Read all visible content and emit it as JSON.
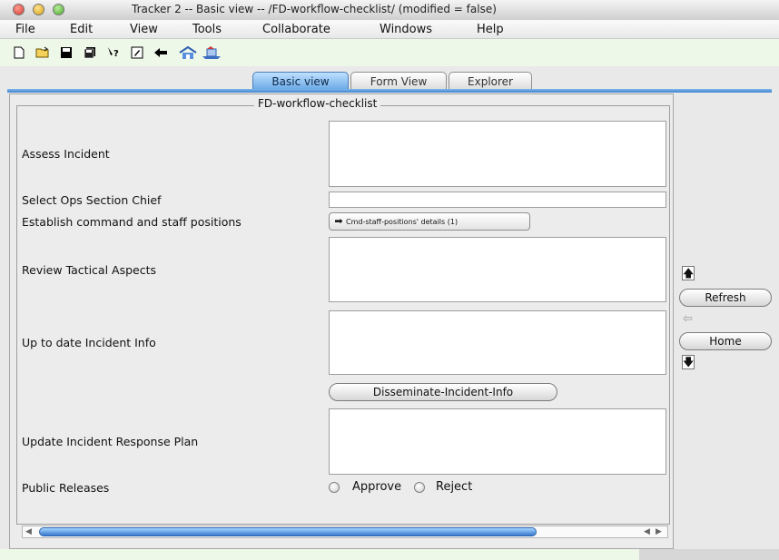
{
  "window": {
    "title": "Tracker 2 -- Basic view -- /FD-workflow-checklist/   (modified = false)"
  },
  "menu": [
    "File",
    "Edit",
    "View",
    "Tools",
    "Collaborate",
    "Windows",
    "Help"
  ],
  "toolbar": {
    "icons": [
      "new-document-icon",
      "open-folder-icon",
      "save-icon",
      "save-all-icon",
      "help-cursor-icon",
      "edit-document-icon",
      "back-arrow-icon",
      "home-icon",
      "send-icon"
    ]
  },
  "tabs": [
    {
      "label": "Basic view",
      "active": true
    },
    {
      "label": "Form View",
      "active": false
    },
    {
      "label": "Explorer",
      "active": false
    }
  ],
  "form": {
    "title": "FD-workflow-checklist",
    "assess_incident": "Assess Incident",
    "select_ops": "Select Ops Section Chief",
    "establish_command": "Establish command and staff positions",
    "cmd_button": "Cmd-staff-positions' details (1)",
    "review_tactical": "Review Tactical Aspects",
    "up_to_date": "Up to date Incident Info",
    "disseminate_button": "Disseminate-Incident-Info",
    "update_plan": "Update Incident Response Plan",
    "public_releases": "Public Releases",
    "approve": "Approve",
    "reject": "Reject"
  },
  "side": {
    "refresh": "Refresh",
    "home": "Home"
  },
  "colors": {
    "tab_active": "#6aa9e6",
    "toolbar_bg": "#eef8e8",
    "scroll_thumb": "#3978cf"
  }
}
